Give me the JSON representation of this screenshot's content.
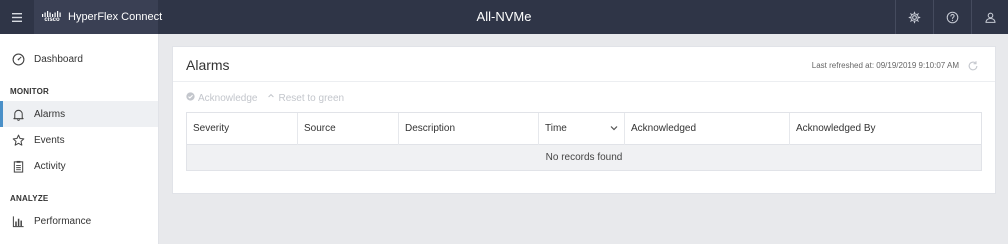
{
  "header": {
    "brand_logo_text": "cisco",
    "brand_name": "HyperFlex Connect",
    "cluster_name": "All-NVMe"
  },
  "sidebar": {
    "items": [
      {
        "label": "Dashboard",
        "icon": "dashboard-gauge-icon"
      },
      {
        "label": "Alarms",
        "icon": "bell-icon",
        "active": true
      },
      {
        "label": "Events",
        "icon": "star-icon"
      },
      {
        "label": "Activity",
        "icon": "clipboard-icon"
      },
      {
        "label": "Performance",
        "icon": "bar-chart-icon"
      }
    ],
    "sections": {
      "monitor": "MONITOR",
      "analyze": "ANALYZE"
    }
  },
  "panel": {
    "title": "Alarms",
    "last_refreshed": "Last refreshed at: 09/19/2019 9:10:07 AM",
    "toolbar": {
      "acknowledge": "Acknowledge",
      "reset": "Reset to green"
    },
    "table": {
      "columns": [
        "Severity",
        "Source",
        "Description",
        "Time",
        "Acknowledged",
        "Acknowledged By"
      ],
      "empty_message": "No records found"
    }
  },
  "colors": {
    "topbar": "#2f3547",
    "active_accent": "#4a90c8"
  }
}
